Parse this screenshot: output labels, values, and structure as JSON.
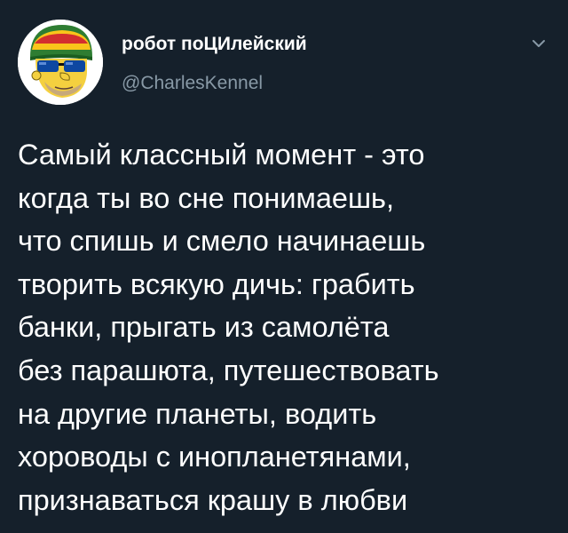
{
  "author": {
    "avatar_icon": "homer-simpson-rasta-avatar-icon",
    "display_name": "робот поЦИлейский",
    "handle": "@CharlesKennel"
  },
  "menu": {
    "icon": "chevron-down-icon"
  },
  "tweet": {
    "lines": [
      "Самый классный момент - это",
      "когда ты во сне понимаешь,",
      "что спишь и смело начинаешь",
      "творить всякую дичь: грабить",
      "банки, прыгать из самолёта",
      "без парашюта, путешествовать",
      "на другие планеты, водить",
      "хороводы с инопланетянами,",
      "признаваться крашу в любви"
    ]
  },
  "colors": {
    "background": "#15202b",
    "text": "#ffffff",
    "secondary_text": "#8899a6"
  }
}
